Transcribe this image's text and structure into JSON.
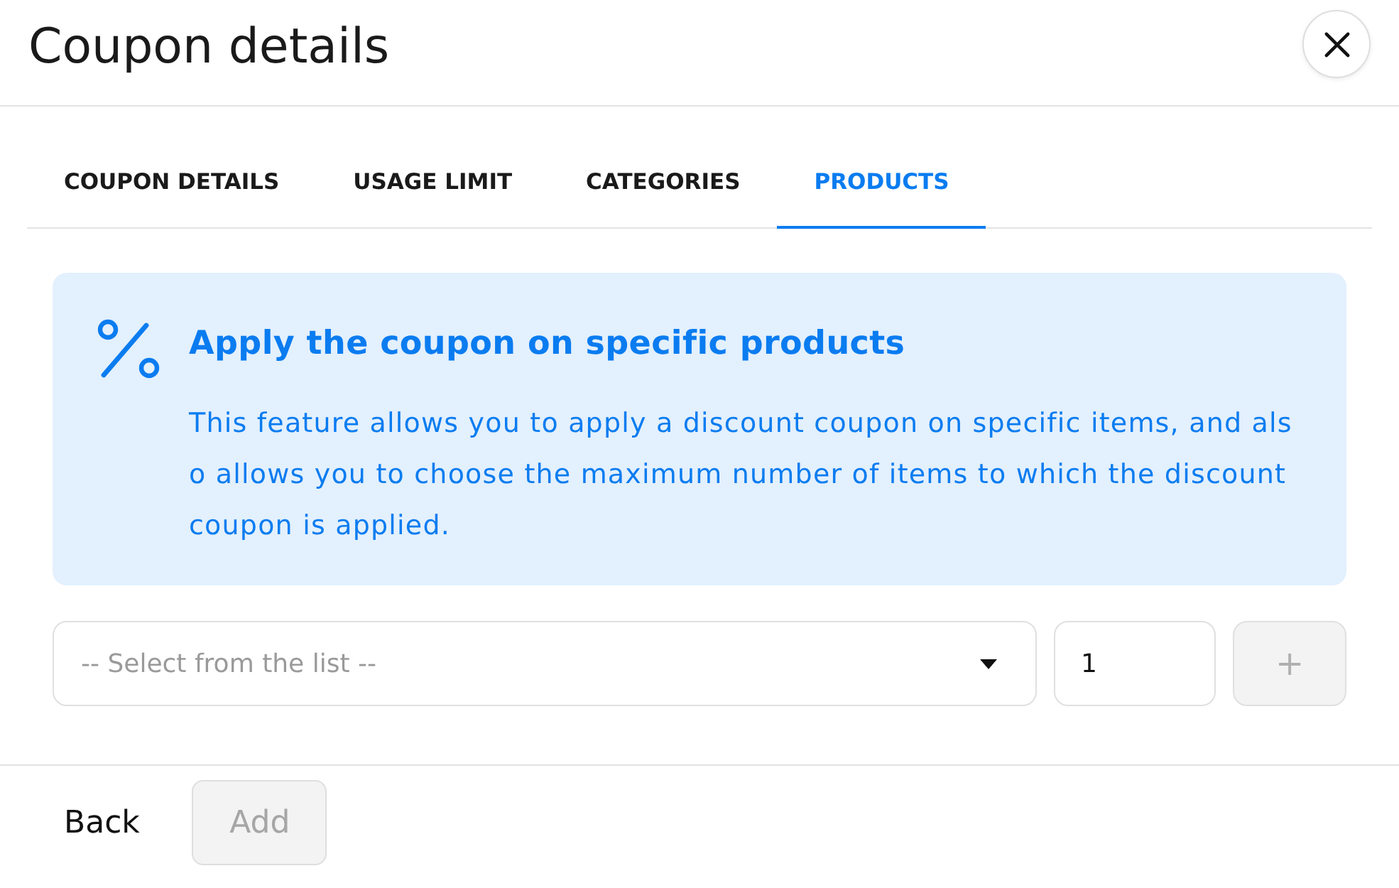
{
  "header": {
    "title": "Coupon details"
  },
  "tabs": [
    {
      "label": "COUPON DETAILS",
      "selected": false
    },
    {
      "label": "USAGE LIMIT",
      "selected": false
    },
    {
      "label": "CATEGORIES",
      "selected": false
    },
    {
      "label": "PRODUCTS",
      "selected": true
    }
  ],
  "info": {
    "heading": "Apply the coupon on specific products",
    "text": "This feature allows you to apply a discount coupon on specific items, and also allows you to choose the maximum number of items to which the discount coupon is applied."
  },
  "product_row": {
    "select": {
      "placeholder": "-- Select from the list --"
    },
    "quantity": {
      "value": "1"
    },
    "plus_button": {
      "label": "+",
      "disabled": true
    }
  },
  "footer": {
    "buttons": [
      {
        "label": "Back",
        "kind": "text",
        "disabled": false
      },
      {
        "label": "Add",
        "kind": "filled",
        "disabled": true
      }
    ]
  }
}
